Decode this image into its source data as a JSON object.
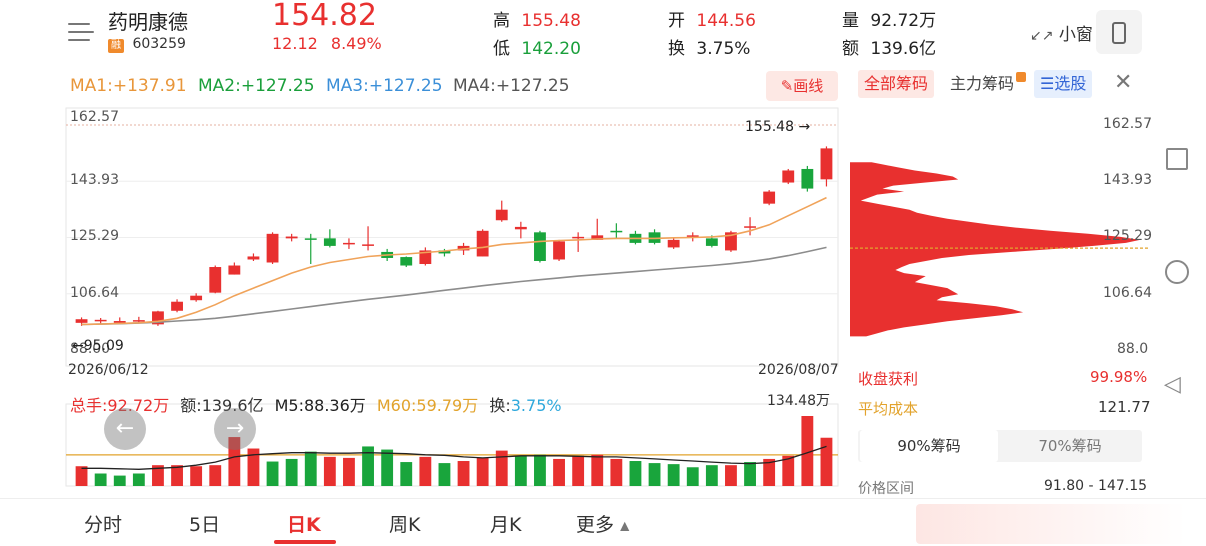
{
  "stock": {
    "name": "药明康德",
    "badge": "融",
    "code": "603259",
    "price": "154.82",
    "change": "12.12",
    "change_pct": "8.49%",
    "high_label": "高",
    "high": "155.48",
    "low_label": "低",
    "low": "142.20",
    "open_label": "开",
    "open": "144.56",
    "turnover_label": "换",
    "turnover": "3.75%",
    "volume_label": "量",
    "volume": "92.72万",
    "amount_label": "额",
    "amount": "139.6亿",
    "small_window": "小窗"
  },
  "ma": {
    "ma1": "MA1:+137.91",
    "ma2": "MA2:+127.25",
    "ma3": "MA3:+127.25",
    "ma4": "MA4:+127.25",
    "draw_label": "画线"
  },
  "price_axis": {
    "ticks": [
      "162.57",
      "143.93",
      "125.29",
      "106.64",
      "88.00"
    ],
    "max_marker": "155.48",
    "min_marker": "95.09",
    "start_date": "2026/06/12",
    "end_date": "2026/08/07"
  },
  "volume_info": {
    "total": "总手:92.72万",
    "amount": "额:139.6亿",
    "m5": "M5:88.36万",
    "m60": "M60:59.79万",
    "turnover_label": "换:",
    "turnover_value": "3.75%",
    "max_volume": "134.48万"
  },
  "chips": {
    "tab_all": "全部筹码",
    "tab_main": "主力筹码",
    "tab_select": "选股",
    "axis": [
      "162.57",
      "143.93",
      "125.29",
      "106.64",
      "88.0"
    ],
    "profit_label": "收盘获利",
    "profit_value": "99.98%",
    "avg_cost_label": "平均成本",
    "avg_cost_value": "121.77",
    "seg_90": "90%筹码",
    "seg_70": "70%筹码",
    "range_label": "价格区间",
    "range_value": "91.80 - 147.15"
  },
  "tabs": [
    "分时",
    "5日",
    "日K",
    "周K",
    "月K",
    "更多"
  ],
  "active_tab": "日K",
  "chart_data": {
    "type": "candlestick",
    "x_start": "2026/06/12",
    "x_end": "2026/08/07",
    "ylim": [
      88.0,
      162.57
    ],
    "candles": [
      {
        "o": 97.0,
        "c": 98.2,
        "h": 98.8,
        "l": 96.0
      },
      {
        "o": 97.5,
        "c": 98.0,
        "h": 98.6,
        "l": 96.5
      },
      {
        "o": 97.0,
        "c": 97.6,
        "h": 98.8,
        "l": 96.5
      },
      {
        "o": 97.5,
        "c": 97.9,
        "h": 99.0,
        "l": 96.8
      },
      {
        "o": 96.5,
        "c": 100.8,
        "h": 101.0,
        "l": 96.0
      },
      {
        "o": 101.0,
        "c": 104.0,
        "h": 104.8,
        "l": 100.5
      },
      {
        "o": 104.5,
        "c": 106.0,
        "h": 106.8,
        "l": 104.0
      },
      {
        "o": 107.0,
        "c": 115.5,
        "h": 116.0,
        "l": 106.8
      },
      {
        "o": 113.0,
        "c": 116.0,
        "h": 117.0,
        "l": 113.0
      },
      {
        "o": 118.0,
        "c": 119.0,
        "h": 120.0,
        "l": 117.5
      },
      {
        "o": 117.0,
        "c": 126.5,
        "h": 127.0,
        "l": 116.5
      },
      {
        "o": 125.0,
        "c": 125.6,
        "h": 126.5,
        "l": 124.0
      },
      {
        "o": 125.0,
        "c": 124.5,
        "h": 126.5,
        "l": 116.5
      },
      {
        "o": 125.0,
        "c": 122.5,
        "h": 128.0,
        "l": 122.0
      },
      {
        "o": 123.0,
        "c": 123.5,
        "h": 125.0,
        "l": 121.5
      },
      {
        "o": 122.5,
        "c": 123.0,
        "h": 129.0,
        "l": 121.0
      },
      {
        "o": 120.5,
        "c": 118.5,
        "h": 121.5,
        "l": 117.5
      },
      {
        "o": 118.8,
        "c": 116.0,
        "h": 119.0,
        "l": 115.5
      },
      {
        "o": 116.5,
        "c": 121.0,
        "h": 122.0,
        "l": 116.0
      },
      {
        "o": 121.0,
        "c": 120.0,
        "h": 121.5,
        "l": 119.0
      },
      {
        "o": 121.0,
        "c": 122.5,
        "h": 123.5,
        "l": 119.5
      },
      {
        "o": 119.0,
        "c": 127.5,
        "h": 128.0,
        "l": 119.0
      },
      {
        "o": 131.0,
        "c": 134.5,
        "h": 137.5,
        "l": 130.5
      },
      {
        "o": 128.0,
        "c": 128.8,
        "h": 130.5,
        "l": 125.0
      },
      {
        "o": 127.0,
        "c": 117.5,
        "h": 127.5,
        "l": 117.0
      },
      {
        "o": 118.0,
        "c": 124.0,
        "h": 124.5,
        "l": 117.5
      },
      {
        "o": 125.0,
        "c": 125.5,
        "h": 127.0,
        "l": 120.5
      },
      {
        "o": 124.5,
        "c": 126.0,
        "h": 131.5,
        "l": 124.5
      },
      {
        "o": 127.5,
        "c": 127.0,
        "h": 130.0,
        "l": 125.0
      },
      {
        "o": 126.5,
        "c": 123.5,
        "h": 127.5,
        "l": 123.0
      },
      {
        "o": 127.0,
        "c": 123.5,
        "h": 128.0,
        "l": 123.0
      },
      {
        "o": 122.0,
        "c": 124.5,
        "h": 125.0,
        "l": 121.5
      },
      {
        "o": 125.5,
        "c": 126.0,
        "h": 127.0,
        "l": 124.0
      },
      {
        "o": 125.0,
        "c": 122.5,
        "h": 126.0,
        "l": 122.0
      },
      {
        "o": 121.0,
        "c": 127.0,
        "h": 127.5,
        "l": 120.5
      },
      {
        "o": 128.5,
        "c": 129.0,
        "h": 132.0,
        "l": 126.0
      },
      {
        "o": 136.5,
        "c": 140.5,
        "h": 141.0,
        "l": 136.0
      },
      {
        "o": 143.5,
        "c": 147.5,
        "h": 148.0,
        "l": 143.0
      },
      {
        "o": 148.0,
        "c": 141.5,
        "h": 149.0,
        "l": 140.5
      },
      {
        "o": 144.56,
        "c": 154.82,
        "h": 155.48,
        "l": 142.2
      }
    ],
    "ma_orange": [
      96.5,
      96.6,
      96.8,
      97.0,
      97.5,
      98.5,
      100.5,
      103.0,
      106.0,
      108.5,
      111.0,
      113.5,
      115.5,
      117.0,
      118.0,
      119.0,
      119.5,
      119.8,
      120.3,
      120.8,
      121.5,
      122.0,
      123.0,
      123.5,
      124.0,
      124.3,
      124.5,
      124.8,
      125.0,
      125.0,
      125.0,
      125.2,
      125.3,
      125.5,
      126.0,
      127.5,
      129.5,
      132.5,
      135.5,
      138.5
    ],
    "ma_gray": [
      96.5,
      96.6,
      96.7,
      96.9,
      97.2,
      97.6,
      98.0,
      98.5,
      99.2,
      100.0,
      100.8,
      101.6,
      102.4,
      103.2,
      104.0,
      104.8,
      105.5,
      106.2,
      107.0,
      107.8,
      108.5,
      109.3,
      110.0,
      110.7,
      111.3,
      111.9,
      112.5,
      113.0,
      113.5,
      114.0,
      114.5,
      115.0,
      115.5,
      116.0,
      116.6,
      117.3,
      118.2,
      119.3,
      120.6,
      122.0
    ],
    "volumes": [
      38,
      24,
      20,
      24,
      40,
      40,
      38,
      40,
      94,
      72,
      47,
      52,
      66,
      56,
      54,
      76,
      70,
      46,
      56,
      44,
      48,
      54,
      68,
      58,
      60,
      52,
      58,
      60,
      52,
      48,
      44,
      42,
      36,
      40,
      40,
      46,
      52,
      58,
      134.48,
      92.72
    ],
    "vol_up": [
      true,
      false,
      false,
      false,
      true,
      true,
      true,
      true,
      true,
      true,
      false,
      false,
      false,
      true,
      true,
      false,
      false,
      false,
      true,
      false,
      true,
      true,
      true,
      false,
      false,
      true,
      true,
      true,
      true,
      false,
      false,
      false,
      false,
      false,
      true,
      false,
      true,
      true,
      true,
      true
    ],
    "vol_ma": [
      34,
      34,
      33,
      32,
      34,
      36,
      40,
      46,
      56,
      60,
      62,
      64,
      64,
      63,
      63,
      64,
      63,
      62,
      60,
      59,
      56,
      54,
      56,
      58,
      58,
      58,
      57,
      56,
      56,
      54,
      52,
      50,
      48,
      46,
      44,
      43,
      45,
      52,
      64,
      76
    ],
    "chips_profile": [
      {
        "p": 150.2,
        "w": 20
      },
      {
        "p": 149.5,
        "w": 30
      },
      {
        "p": 148.5,
        "w": 45
      },
      {
        "p": 147.5,
        "w": 60
      },
      {
        "p": 146.5,
        "w": 80
      },
      {
        "p": 145.5,
        "w": 95
      },
      {
        "p": 144.5,
        "w": 100
      },
      {
        "p": 143.5,
        "w": 70
      },
      {
        "p": 142.5,
        "w": 40
      },
      {
        "p": 141.5,
        "w": 30
      },
      {
        "p": 140.5,
        "w": 50
      },
      {
        "p": 139.5,
        "w": 25
      },
      {
        "p": 137.5,
        "w": 10
      },
      {
        "p": 136.5,
        "w": 25
      },
      {
        "p": 135.5,
        "w": 40
      },
      {
        "p": 134.5,
        "w": 55
      },
      {
        "p": 133.5,
        "w": 62
      },
      {
        "p": 132.5,
        "w": 75
      },
      {
        "p": 131.5,
        "w": 90
      },
      {
        "p": 130.5,
        "w": 110
      },
      {
        "p": 129.5,
        "w": 130
      },
      {
        "p": 128.5,
        "w": 155
      },
      {
        "p": 127.5,
        "w": 185
      },
      {
        "p": 126.5,
        "w": 220
      },
      {
        "p": 125.5,
        "w": 250
      },
      {
        "p": 124.5,
        "w": 268
      },
      {
        "p": 123.5,
        "w": 255
      },
      {
        "p": 122.5,
        "w": 225
      },
      {
        "p": 121.5,
        "w": 190
      },
      {
        "p": 120.5,
        "w": 150
      },
      {
        "p": 119.5,
        "w": 110
      },
      {
        "p": 118.5,
        "w": 85
      },
      {
        "p": 117.5,
        "w": 70
      },
      {
        "p": 116.5,
        "w": 55
      },
      {
        "p": 115.5,
        "w": 48
      },
      {
        "p": 114.5,
        "w": 42
      },
      {
        "p": 113.5,
        "w": 50
      },
      {
        "p": 112.5,
        "w": 70
      },
      {
        "p": 111.5,
        "w": 65
      },
      {
        "p": 110.5,
        "w": 60
      },
      {
        "p": 109.5,
        "w": 75
      },
      {
        "p": 108.5,
        "w": 90
      },
      {
        "p": 107.5,
        "w": 95
      },
      {
        "p": 106.5,
        "w": 100
      },
      {
        "p": 105.5,
        "w": 85
      },
      {
        "p": 104.5,
        "w": 80
      },
      {
        "p": 103.5,
        "w": 110
      },
      {
        "p": 102.5,
        "w": 135
      },
      {
        "p": 101.5,
        "w": 150
      },
      {
        "p": 100.5,
        "w": 160
      },
      {
        "p": 99.5,
        "w": 140
      },
      {
        "p": 98.5,
        "w": 115
      },
      {
        "p": 97.5,
        "w": 90
      },
      {
        "p": 96.5,
        "w": 70
      },
      {
        "p": 95.5,
        "w": 50
      },
      {
        "p": 94.5,
        "w": 35
      },
      {
        "p": 93.5,
        "w": 25
      },
      {
        "p": 92.5,
        "w": 15
      }
    ]
  },
  "colors": {
    "up": "#e8302f",
    "down": "#19a53c",
    "ma_orange": "#f0a35a",
    "ma_gray": "#8c8c8c",
    "vol_ma": "#222222",
    "chips": "#e8302f"
  }
}
